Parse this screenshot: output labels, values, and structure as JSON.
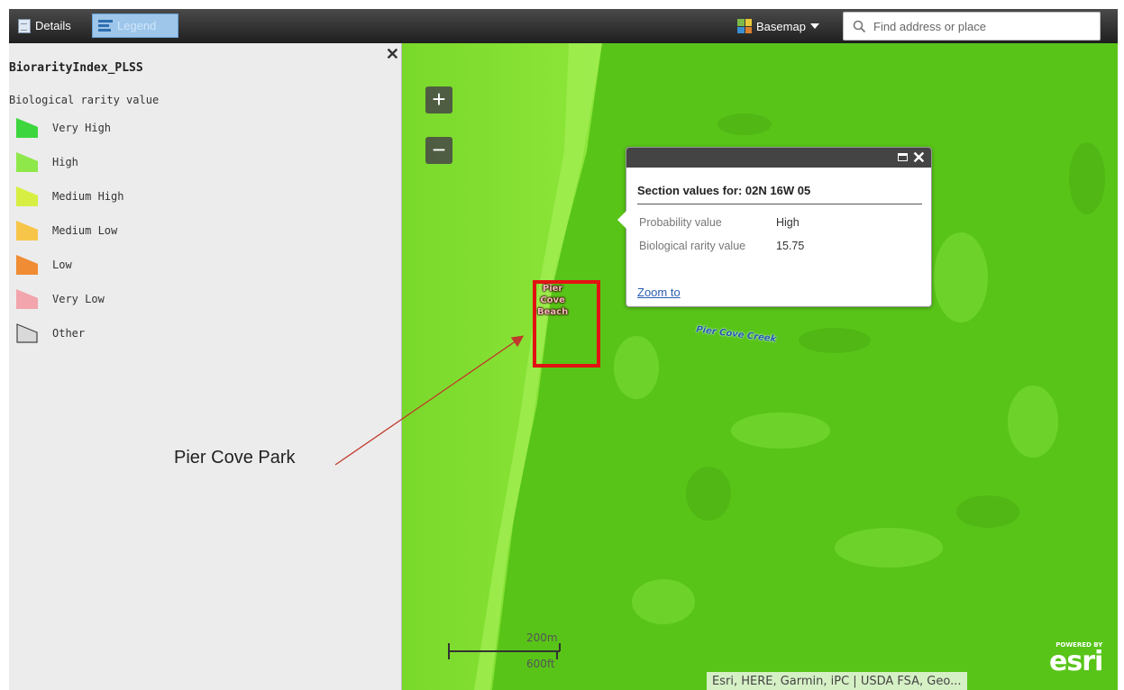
{
  "toolbar": {
    "tabs": [
      {
        "label": "Details",
        "icon": "document-icon"
      },
      {
        "label": "Legend",
        "icon": "list-icon"
      }
    ],
    "basemap_label": "Basemap",
    "search_placeholder": "Find address or place"
  },
  "legend": {
    "layer_title": "BiorarityIndex_PLSS",
    "field_name": "Biological rarity value",
    "items": [
      {
        "label": "Very High",
        "color": "#3ed63e"
      },
      {
        "label": "High",
        "color": "#8ee84a"
      },
      {
        "label": "Medium High",
        "color": "#d7ef43"
      },
      {
        "label": "Medium Low",
        "color": "#f7c54a"
      },
      {
        "label": "Low",
        "color": "#f08c33"
      },
      {
        "label": "Very Low",
        "color": "#f2a5ad"
      },
      {
        "label": "Other",
        "color": "#d9d9d9"
      }
    ]
  },
  "map": {
    "zoom_in": "+",
    "zoom_out": "−",
    "popup": {
      "title": "Section values for: 02N 16W 05",
      "rows": [
        {
          "label": "Probability value",
          "value": "High"
        },
        {
          "label": "Biological rarity value",
          "value": "15.75"
        }
      ],
      "zoom_link": "Zoom to"
    },
    "labels": {
      "beach": [
        "Pier",
        "Cove",
        "Beach"
      ],
      "creek": "Pier Cove Creek"
    },
    "scalebar": {
      "metric": "200m",
      "imperial": "600ft"
    },
    "attribution": "Esri, HERE, Garmin, iPC | USDA FSA, Geo...",
    "logo": {
      "powered_by": "POWERED BY",
      "brand": "esri"
    }
  },
  "annotation": {
    "text": "Pier Cove Park",
    "color": "#c0392b"
  }
}
